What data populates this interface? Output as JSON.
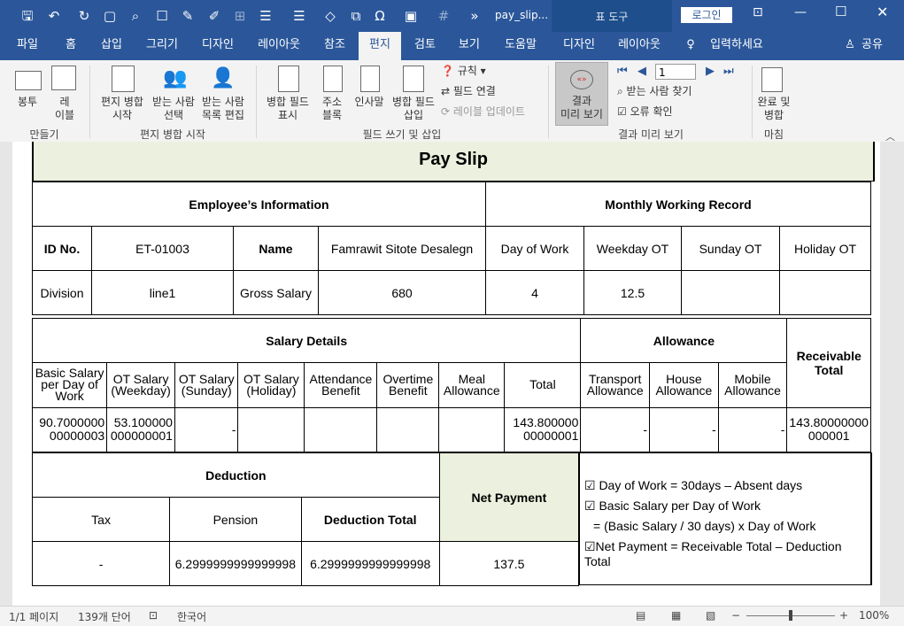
{
  "title": {
    "doc": "pay_slip...",
    "context_tab": "표 도구",
    "login": "로그인"
  },
  "tabs": [
    "파일",
    "홈",
    "삽입",
    "그리기",
    "디자인",
    "레이아웃",
    "참조",
    "편지",
    "검토",
    "보기",
    "도움말",
    "디자인",
    "레이아웃"
  ],
  "tell_me": "입력하세요",
  "share": "공유",
  "ribbon": {
    "envelopes": "봉투",
    "labels_1": "레",
    "labels_2": "이블",
    "start_merge_1": "편지 병합",
    "start_merge_2": "시작",
    "select_recipients_1": "받는 사람",
    "select_recipients_2": "선택",
    "edit_list_1": "받는 사람",
    "edit_list_2": "목록 편집",
    "highlight_1": "병합 필드",
    "highlight_2": "표시",
    "address_1": "주소",
    "address_2": "블록",
    "greeting": "인사말",
    "insert_field_1": "병합 필드",
    "insert_field_2": "삽입",
    "rules": "규칙",
    "match_fields": "필드 연결",
    "update_labels": "레이블 업데이트",
    "preview_1": "결과",
    "preview_2": "미리 보기",
    "record_number": "1",
    "find_recipient": "받는 사람 찾기",
    "check_errors": "오류 확인",
    "finish_1": "완료 및",
    "finish_2": "병합",
    "group_create": "만들기",
    "group_start": "편지 병합 시작",
    "group_write": "필드 쓰기 및 삽입",
    "group_preview": "결과 미리 보기",
    "group_finish": "마침"
  },
  "document": {
    "title": "Pay Slip",
    "emp_info": "Employee’s Information",
    "monthly": "Monthly Working Record",
    "id_label": "ID No.",
    "id_value": "ET-01003",
    "name_label": "Name",
    "name_value": "Famrawit Sitote Desalegn",
    "day_of_work": "Day of Work",
    "weekday_ot": "Weekday OT",
    "sunday_ot": "Sunday OT",
    "holiday_ot": "Holiday OT",
    "division_label": "Division",
    "division_value": "line1",
    "gross_label": "Gross Salary",
    "gross_value": "680",
    "dow_value": "4",
    "weekday_value": "12.5",
    "salary_details": "Salary Details",
    "allowance": "Allowance",
    "receivable_total": "Receivable Total",
    "salary_cols": [
      "Basic Salary per Day of Work",
      "OT Salary (Weekday)",
      "OT Salary (Sunday)",
      "OT Salary (Holiday)",
      "Attendance Benefit",
      "Overtime Benefit",
      "Meal Allowance",
      "Total"
    ],
    "allow_cols": [
      "Transport Allowance",
      "House Allowance",
      "Mobile Allowance"
    ],
    "salary_vals": [
      "90.7000000 00000003",
      "53.100000 000000001",
      "-",
      "",
      "",
      "",
      "",
      "143.800000 00000001"
    ],
    "allow_vals": [
      "-",
      "-",
      "-"
    ],
    "receivable_val": "143.80000000 000001",
    "deduction": "Deduction",
    "net_payment": "Net Payment",
    "tax": "Tax",
    "pension": "Pension",
    "deduction_total": "Deduction Total",
    "tax_val": "-",
    "pension_val": "6.2999999999999998",
    "deduction_total_val": "6.2999999999999998",
    "net_val": "137.5",
    "notes": [
      "☑ Day of Work = 30days – Absent days",
      "☑ Basic Salary per Day of Work",
      "= (Basic Salary / 30 days) x Day of Work",
      "☑Net Payment = Receivable Total – Deduction Total"
    ]
  },
  "status": {
    "page": "1/1 페이지",
    "words": "139개 단어",
    "lang": "한국어",
    "zoom": "100%"
  },
  "colors": {
    "brand": "#2b579a",
    "header_fill": "#ebf1de"
  }
}
